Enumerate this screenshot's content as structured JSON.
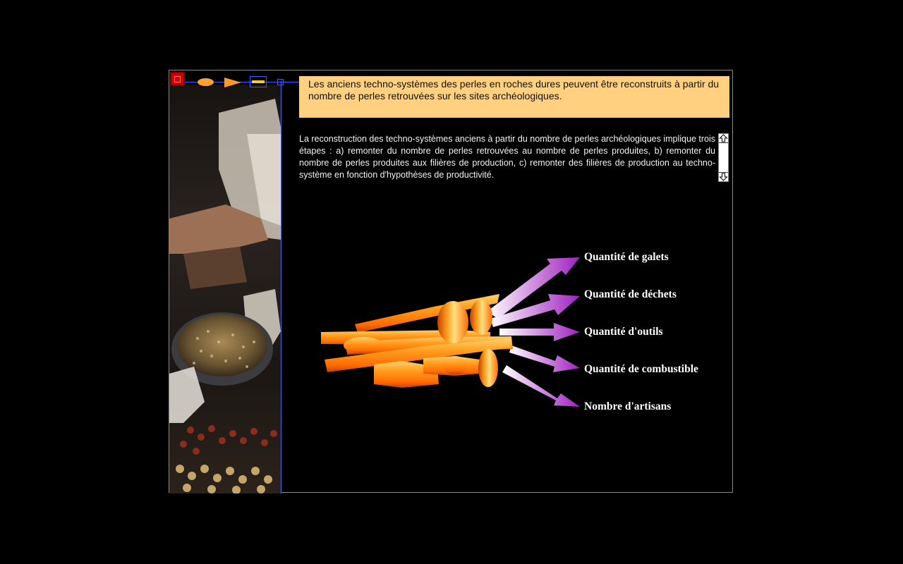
{
  "navigation": {
    "home_icon": "home-square-icon",
    "previous_icon": "ellipse-icon",
    "next_icon": "arrow-right-icon",
    "menu_icon": "bar-icon",
    "small_icon": "square-icon"
  },
  "summary": {
    "text": "Les anciens techno-systèmes des perles en roches dures peuvent être reconstruits à partir du nombre de perles retrouvées sur les sites archéologiques."
  },
  "body": {
    "text": "La reconstruction des techno-systèmes anciens à partir du nombre de perles archéologiques implique trois étapes : a) remonter du nombre de perles retrouvées au nombre de perles produites, b) remonter du nombre de perles produites aux filières de production, c) remonter des filières de production au techno-système en fonction d'hypothèses de productivité."
  },
  "diagram": {
    "labels": [
      "Quantité de galets",
      "Quantité de déchets",
      "Quantité d'outils",
      "Quantité de combustible",
      "Nombre d'artisans"
    ]
  },
  "colors": {
    "summary_bg": "#ffd080",
    "accent_blue": "#3a5bff",
    "arrow_purple": "#a020c0",
    "bead_orange": "#ff9a1a"
  }
}
